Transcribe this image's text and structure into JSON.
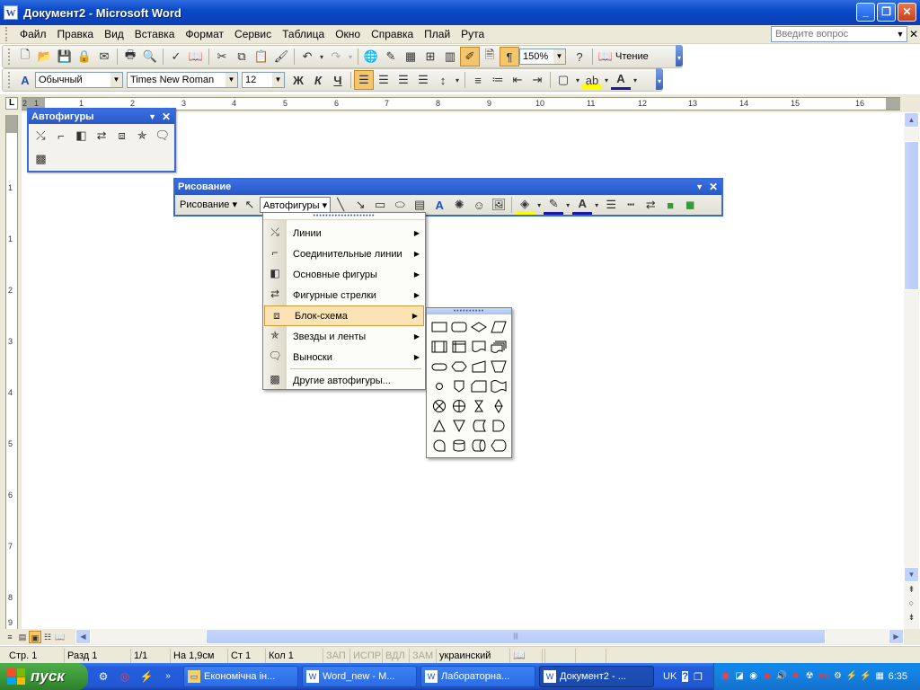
{
  "window": {
    "title": "Документ2 - Microsoft Word",
    "app_icon": "W",
    "minimize": "_",
    "restore": "❐",
    "close": "✕"
  },
  "menu": {
    "items": [
      "Файл",
      "Правка",
      "Вид",
      "Вставка",
      "Формат",
      "Сервис",
      "Таблица",
      "Окно",
      "Справка",
      "Плай",
      "Рута"
    ],
    "ask_placeholder": "Введите вопрос",
    "close_doc": "✕"
  },
  "standard_toolbar": {
    "zoom": "150%",
    "reading_label": "Чтение"
  },
  "format_toolbar": {
    "style": "Обычный",
    "font": "Times New Roman",
    "size": "12",
    "bold": "Ж",
    "italic": "К",
    "underline": "Ч"
  },
  "ruler": {
    "corner": "L",
    "h_ticks": [
      "2",
      "1",
      "1",
      "2",
      "3",
      "4",
      "5",
      "6",
      "7",
      "8",
      "9",
      "10",
      "11",
      "12",
      "13",
      "14",
      "15",
      "16"
    ],
    "v_ticks": [
      "1",
      "1",
      "2",
      "3",
      "4",
      "5",
      "6",
      "7",
      "8",
      "9"
    ]
  },
  "autoshapes_palette": {
    "title": "Автофигуры"
  },
  "drawing_toolbar": {
    "title": "Рисование",
    "drawing_menu": "Рисование ▾",
    "autoshapes_menu": "Автофигуры ▾"
  },
  "autoshapes_menu": {
    "items": [
      {
        "label": "Линии",
        "icon": "lines-icon",
        "submenu": true
      },
      {
        "label": "Соединительные линии",
        "icon": "connectors-icon",
        "submenu": true
      },
      {
        "label": "Основные фигуры",
        "icon": "basic-shapes-icon",
        "submenu": true
      },
      {
        "label": "Фигурные стрелки",
        "icon": "block-arrows-icon",
        "submenu": true
      },
      {
        "label": "Блок-схема",
        "icon": "flowchart-icon",
        "submenu": true,
        "highlighted": true
      },
      {
        "label": "Звезды и ленты",
        "icon": "stars-icon",
        "submenu": true
      },
      {
        "label": "Выноски",
        "icon": "callouts-icon",
        "submenu": true
      },
      {
        "label": "Другие автофигуры...",
        "icon": "more-autoshapes-icon",
        "submenu": false
      }
    ]
  },
  "status": {
    "page": "Стр. 1",
    "section": "Разд 1",
    "pages": "1/1",
    "at": "На 1,9см",
    "line": "Ст 1",
    "col": "Кол 1",
    "rec": "ЗАП",
    "trk": "ИСПР",
    "ext": "ВДЛ",
    "ovr": "ЗАМ",
    "language": "украинский"
  },
  "taskbar": {
    "start": "пуск",
    "buttons": [
      {
        "label": "Економічна ін...",
        "icon": "folder-icon",
        "active": false
      },
      {
        "label": "Word_new - M...",
        "icon": "word-icon",
        "active": false
      },
      {
        "label": "Лабораторна...",
        "icon": "word-icon",
        "active": false
      },
      {
        "label": "Документ2 - ...",
        "icon": "word-icon",
        "active": true
      }
    ],
    "lang": "UK",
    "clock": "6:35"
  }
}
